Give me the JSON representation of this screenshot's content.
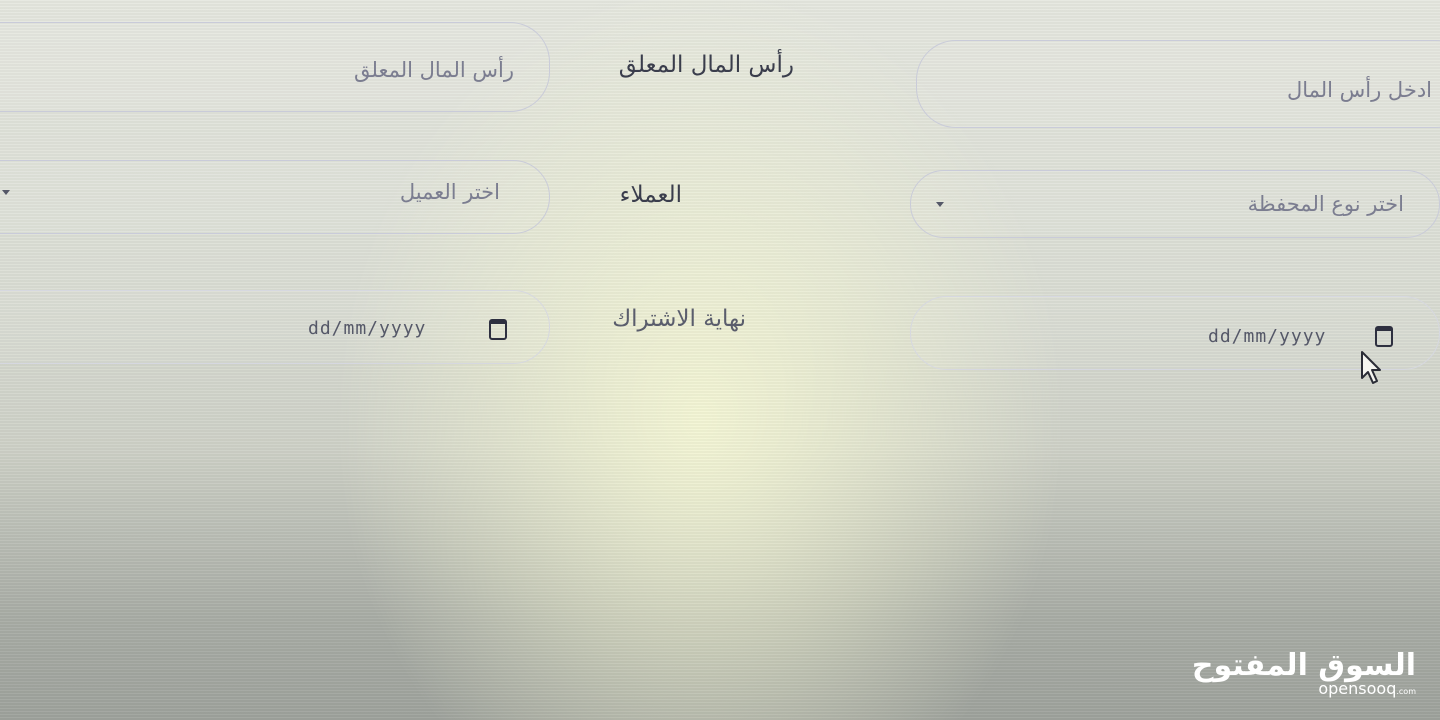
{
  "row_capital": {
    "label": "رأس المال المعلق",
    "suspended_capital_placeholder": "رأس المال المعلق",
    "capital_placeholder": "ادخل رأس المال"
  },
  "row_clients": {
    "label": "العملاء",
    "client_placeholder": "اختر العميل",
    "portfolio_type_placeholder": "اختر نوع المحفظة"
  },
  "row_subscription": {
    "label": "نهاية الاشتراك",
    "date_placeholder_left": "dd/mm/yyyy",
    "date_placeholder_right": "dd/mm/yyyy"
  },
  "watermark": {
    "brand_ar": "السوق المفتوح",
    "brand_en": "opensooq",
    "brand_tld": ".com"
  },
  "icons": [
    "calendar-icon",
    "chevron-down-icon",
    "mouse-cursor-icon"
  ]
}
